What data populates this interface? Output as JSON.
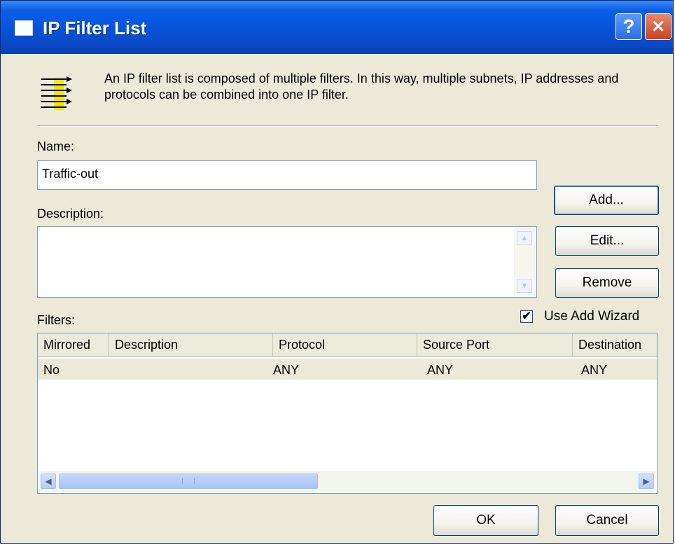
{
  "window": {
    "title": "IP Filter List"
  },
  "titlebar": {
    "help_icon": "?",
    "close_icon": "✕"
  },
  "intro": {
    "text": "An IP filter list is composed of multiple filters. In this way, multiple subnets, IP addresses and protocols can be combined into one IP filter."
  },
  "name": {
    "label": "Name:",
    "value": "Traffic-out"
  },
  "description": {
    "label": "Description:",
    "value": ""
  },
  "buttons": {
    "add": "Add...",
    "edit": "Edit...",
    "remove": "Remove",
    "ok": "OK",
    "cancel": "Cancel"
  },
  "wizard": {
    "label": "Use Add Wizard",
    "checked": true
  },
  "filters": {
    "label": "Filters:",
    "columns": [
      "Mirrored",
      "Description",
      "Protocol",
      "Source Port",
      "Destination"
    ],
    "rows": [
      {
        "mirrored": "No",
        "description": "",
        "protocol": "ANY",
        "source_port": "ANY",
        "destination": "ANY"
      }
    ]
  },
  "colors": {
    "titlebar": "#0653d8",
    "dialog_bg": "#ece9d8",
    "selected_row": "#ece9d8"
  }
}
